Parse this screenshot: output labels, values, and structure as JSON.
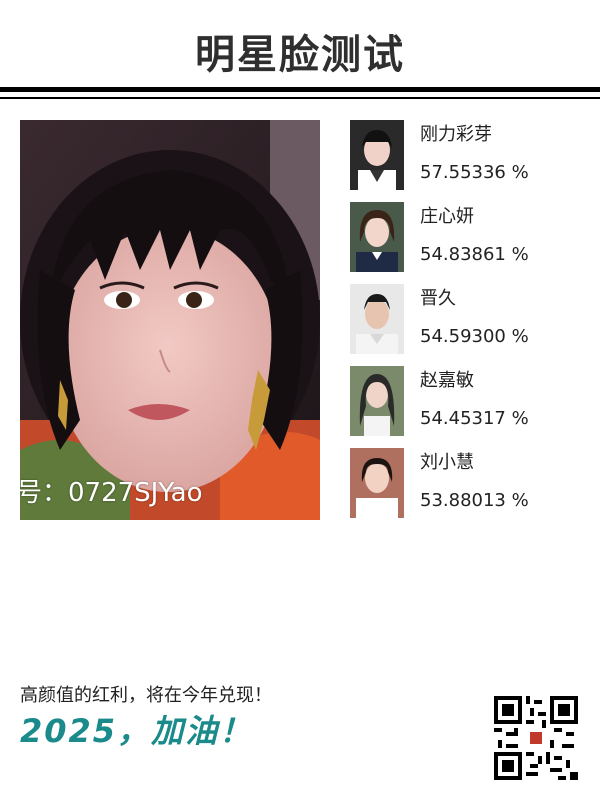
{
  "header": {
    "title": "明星脸测试"
  },
  "photo": {
    "watermark": "号：0727SJYao"
  },
  "matches": [
    {
      "name": "刚力彩芽",
      "score": "57.55336 %"
    },
    {
      "name": "庄心妍",
      "score": "54.83861 %"
    },
    {
      "name": "晋久",
      "score": "54.59300 %"
    },
    {
      "name": "赵嘉敏",
      "score": "54.45317 %"
    },
    {
      "name": "刘小慧",
      "score": "53.88013 %"
    }
  ],
  "footer": {
    "slogan": "高颜值的红利，将在今年兑现！",
    "cheer": "2025，加油！"
  },
  "colors": {
    "cheer": "#1a8a8a",
    "rule": "#000000"
  },
  "icons": [
    "qr-code-icon"
  ]
}
